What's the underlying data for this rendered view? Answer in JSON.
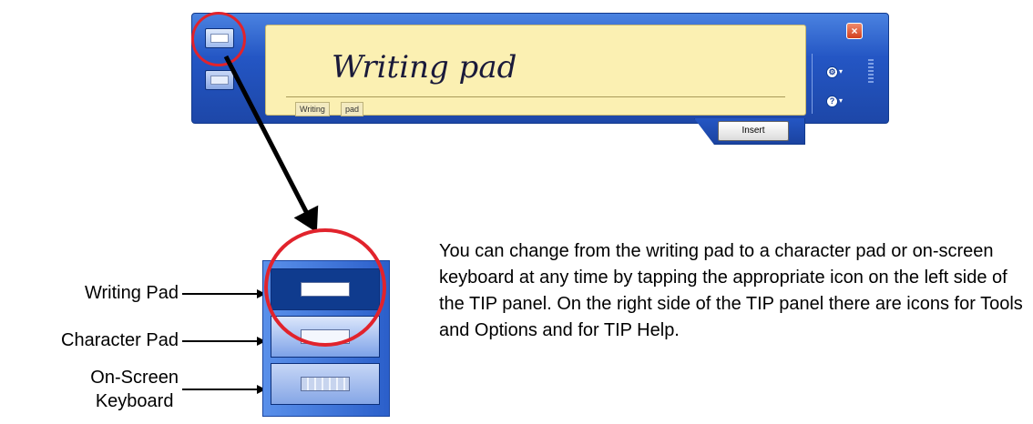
{
  "tip_panel": {
    "handwriting": "Writing pad",
    "recognized_words": [
      "Writing",
      "pad"
    ],
    "insert_label": "Insert",
    "close_glyph": "×",
    "tools_options_icon": "gear-icon",
    "help_icon": "help-icon"
  },
  "pad_selector": {
    "labels": {
      "writing_pad": "Writing Pad",
      "character_pad": "Character Pad",
      "on_screen_keyboard_line1": "On-Screen",
      "on_screen_keyboard_line2": "Keyboard"
    }
  },
  "description": "You can change from the writing pad to a character pad or on-screen keyboard at any time by tapping the appropriate icon on the left side of the TIP panel. On the right side of the TIP panel there are icons for Tools and Options and for TIP Help.",
  "colors": {
    "panel_blue": "#2456c4",
    "writing_area": "#fbf0b2",
    "highlight_red": "#e1232c"
  }
}
